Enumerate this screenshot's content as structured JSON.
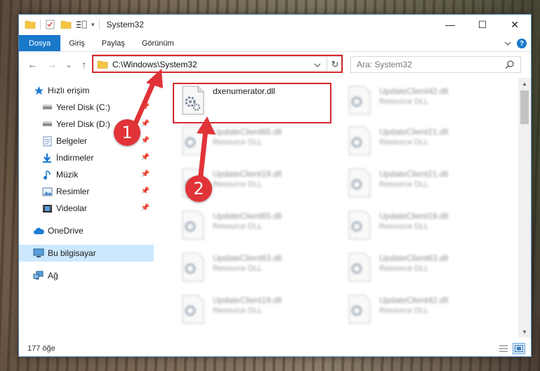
{
  "window": {
    "title": "System32",
    "controls": [
      "—",
      "☐",
      "✕"
    ]
  },
  "ribbon": {
    "tabs": [
      "Dosya",
      "Giriş",
      "Paylaş",
      "Görünüm"
    ],
    "expand_icon": "chevron-down-icon",
    "help_label": "?"
  },
  "nav": {
    "back": "←",
    "forward": "→",
    "recent": "⌄",
    "up": "↑",
    "address": "C:\\Windows\\System32",
    "refresh": "↻",
    "search_placeholder": "Ara: System32"
  },
  "sidebar": {
    "items": [
      {
        "label": "Hızlı erişim",
        "icon": "star-icon",
        "pinned": false
      },
      {
        "label": "Yerel Disk (C:)",
        "icon": "drive-icon",
        "pinned": true
      },
      {
        "label": "Yerel Disk (D:)",
        "icon": "drive-icon",
        "pinned": true
      },
      {
        "label": "Belgeler",
        "icon": "documents-icon",
        "pinned": true
      },
      {
        "label": "İndirmeler",
        "icon": "download-icon",
        "pinned": true
      },
      {
        "label": "Müzik",
        "icon": "music-icon",
        "pinned": true
      },
      {
        "label": "Resimler",
        "icon": "pictures-icon",
        "pinned": true
      },
      {
        "label": "Videolar",
        "icon": "video-icon",
        "pinned": true
      },
      {
        "label": "OneDrive",
        "icon": "cloud-icon",
        "pinned": false
      },
      {
        "label": "Bu bilgisayar",
        "icon": "computer-icon",
        "pinned": false
      },
      {
        "label": "Ağ",
        "icon": "network-icon",
        "pinned": false
      }
    ]
  },
  "files": [
    {
      "name": "dxenumerator.dll",
      "type": "",
      "highlighted": true
    },
    {
      "name": "UpdateClient42.dll",
      "type": "Resource DLL"
    },
    {
      "name": "UpdateClient65.dll",
      "type": "Resource DLL"
    },
    {
      "name": "UpdateClient21.dll",
      "type": "Resource DLL"
    },
    {
      "name": "UpdateClient19.dll",
      "type": "Resource DLL"
    },
    {
      "name": "UpdateClient21.dll",
      "type": "Resource DLL"
    },
    {
      "name": "UpdateClient65.dll",
      "type": "Resource DLL"
    },
    {
      "name": "UpdateClient19.dll",
      "type": "Resource DLL"
    },
    {
      "name": "UpdateClient63.dll",
      "type": "Resource DLL"
    },
    {
      "name": "UpdateClient63.dll",
      "type": "Resource DLL"
    },
    {
      "name": "UpdateClient19.dll",
      "type": "Resource DLL"
    },
    {
      "name": "UpdateClient42.dll",
      "type": "Resource DLL"
    }
  ],
  "status": {
    "count": "177 öğe"
  },
  "callouts": [
    "1",
    "2"
  ],
  "colors": {
    "accent": "#1979ca",
    "highlight_red": "#d6272c",
    "callout_red": "#e13338",
    "selection": "#cce8ff"
  }
}
